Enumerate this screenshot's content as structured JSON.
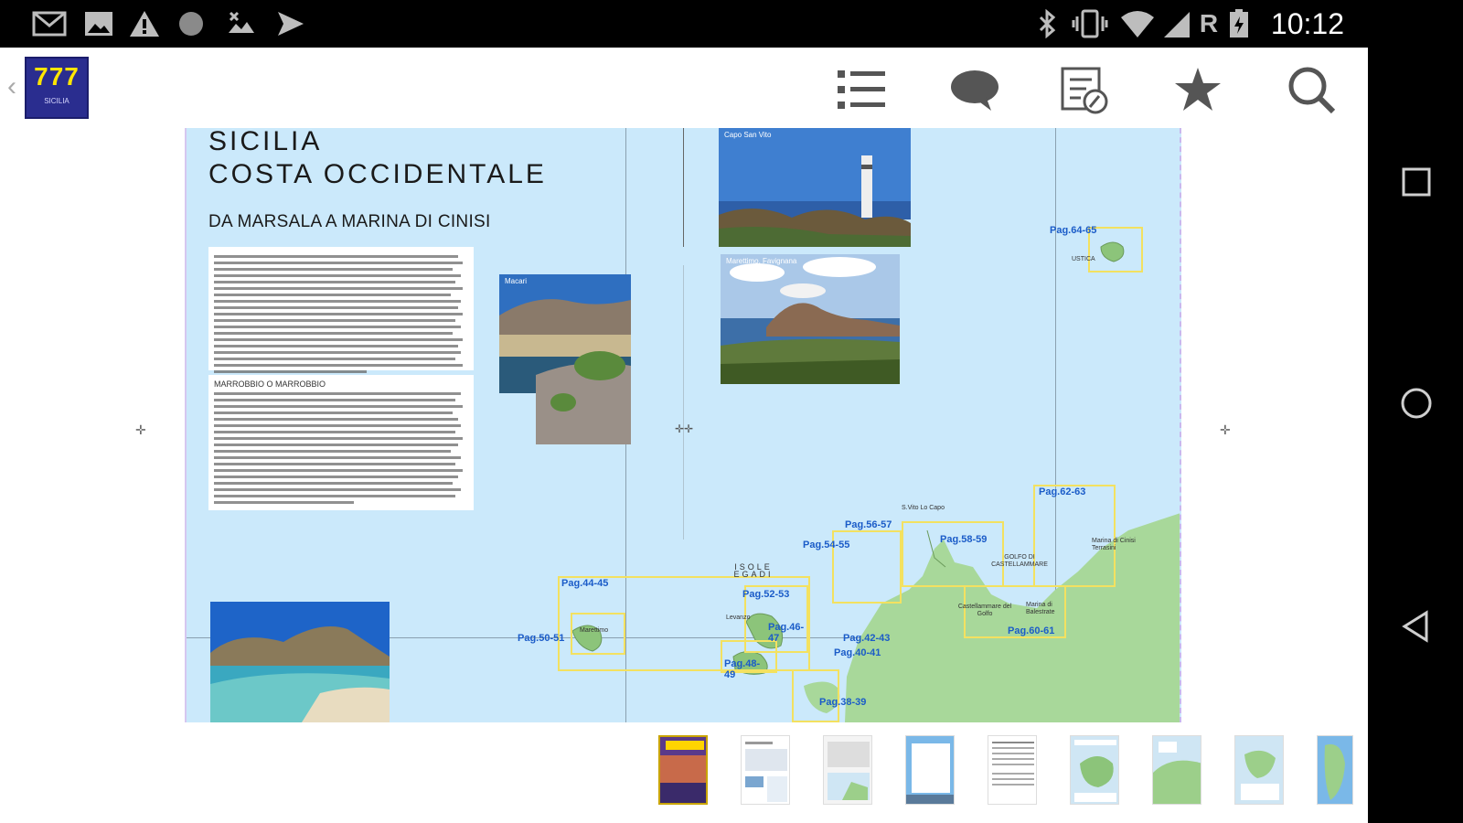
{
  "status_bar": {
    "time": "10:12",
    "icons_left": [
      "gmail-icon",
      "gallery-icon",
      "warning-icon",
      "record-icon",
      "image-edit-icon",
      "send-icon"
    ],
    "icons_right": [
      "bluetooth-icon",
      "vibrate-icon",
      "wifi-icon",
      "signal-icon",
      "roaming-icon",
      "battery-icon"
    ],
    "roaming_label": "R"
  },
  "toolbar": {
    "logo_number": "777",
    "logo_caption": "SICILIA",
    "buttons": [
      "toc-list-icon",
      "comments-icon",
      "notes-icon",
      "bookmark-star-icon",
      "search-icon"
    ]
  },
  "page": {
    "title_line1": "SICILIA",
    "title_line2": "COSTA OCCIDENTALE",
    "subtitle": "DA MARSALA A MARINA DI CINISI",
    "box2_heading": "MARROBBIO O MARROBBIO",
    "photo_labels": {
      "bay": "Macari",
      "island": "Marettimo, Favignana",
      "lighthouse": "Capo San Vito"
    },
    "map_labels": {
      "isole_egadi": "ISOLE EGADI",
      "golfo": "GOLFO DI CASTELLAMMARE",
      "san_vito": "S.Vito Lo Capo",
      "castellammare": "Castellammare del Golfo",
      "marina_cinisi": "Marina di Cinisi Terrasini",
      "balestrate": "Marina di Balestrate",
      "ustica": "USTICA",
      "marettimo": "Marettimo",
      "levanzo": "Levanzo"
    },
    "page_refs": [
      "Pag.64-65",
      "Pag.62-63",
      "Pag.56-57",
      "Pag.58-59",
      "Pag.54-55",
      "Pag.44-45",
      "Pag.52-53",
      "Pag.46-47",
      "Pag.50-51",
      "Pag.42-43",
      "Pag.40-41",
      "Pag.48-49",
      "Pag.60-61",
      "Pag.38-39"
    ]
  },
  "thumbnails": {
    "count": 9,
    "items": [
      "cover",
      "page-1",
      "page-2",
      "page-3",
      "page-4",
      "page-5",
      "page-6",
      "page-7",
      "page-8"
    ]
  },
  "nav_bar": {
    "buttons": [
      "recents-square-icon",
      "home-circle-icon",
      "back-triangle-icon"
    ]
  }
}
